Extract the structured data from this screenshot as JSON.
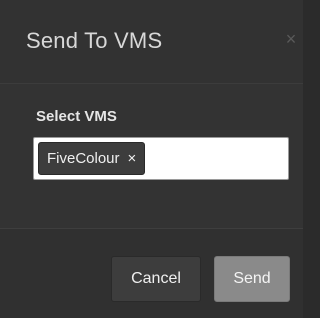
{
  "dialog": {
    "title": "Send To VMS",
    "close_icon": "close-icon"
  },
  "form": {
    "select_label": "Select VMS",
    "selected_tags": [
      {
        "label": "FiveColour",
        "remove_glyph": "×"
      }
    ]
  },
  "footer": {
    "cancel_label": "Cancel",
    "send_label": "Send"
  },
  "colors": {
    "dialog_background": "#303030",
    "primary_button": "#8a8a8a",
    "secondary_button": "#3d3d3d",
    "text": "#e6e6e6"
  }
}
